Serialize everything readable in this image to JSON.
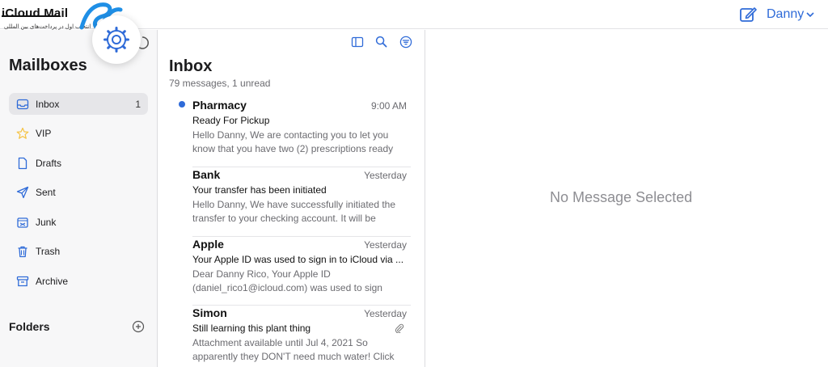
{
  "brand": {
    "title": "iCloud Mail",
    "tagline": "انتخاب اول در پرداخت‌های بین المللی"
  },
  "toolbar": {
    "compose_icon": "compose-icon",
    "account_name": "Danny"
  },
  "sidebar": {
    "title": "Mailboxes",
    "items": [
      {
        "label": "Inbox",
        "count": "1",
        "icon": "inbox-icon"
      },
      {
        "label": "VIP",
        "count": "",
        "icon": "star-icon"
      },
      {
        "label": "Drafts",
        "count": "",
        "icon": "document-icon"
      },
      {
        "label": "Sent",
        "count": "",
        "icon": "paper-plane-icon"
      },
      {
        "label": "Junk",
        "count": "",
        "icon": "junk-tray-icon"
      },
      {
        "label": "Trash",
        "count": "",
        "icon": "trash-icon"
      },
      {
        "label": "Archive",
        "count": "",
        "icon": "archive-box-icon"
      }
    ],
    "folders_title": "Folders"
  },
  "message_list": {
    "title": "Inbox",
    "subtitle": "79 messages, 1 unread",
    "messages": [
      {
        "sender": "Pharmacy",
        "time": "9:00 AM",
        "subject": "Ready For Pickup",
        "preview": "Hello Danny, We are contacting you to let you know that you have two (2) prescriptions ready",
        "unread": true
      },
      {
        "sender": "Bank",
        "time": "Yesterday",
        "subject": "Your transfer has been initiated",
        "preview": "Hello Danny, We have successfully initiated the transfer to your checking account. It will be",
        "unread": false
      },
      {
        "sender": "Apple",
        "time": "Yesterday",
        "subject": "Your Apple ID was used to sign in to iCloud via ...",
        "preview": "Dear Danny Rico, Your Apple ID (daniel_rico1@icloud.com) was used to sign",
        "unread": false
      },
      {
        "sender": "Simon",
        "time": "Yesterday",
        "subject": "Still learning this plant thing",
        "preview": "Attachment available until Jul 4, 2021 So apparently they DON'T need much water! Click",
        "unread": false
      }
    ]
  },
  "reading_pane": {
    "empty_text": "No Message Selected"
  },
  "colors": {
    "accent": "#2f6bd8",
    "star": "#f5c242",
    "sidebar_bg": "#f7f7f8"
  }
}
